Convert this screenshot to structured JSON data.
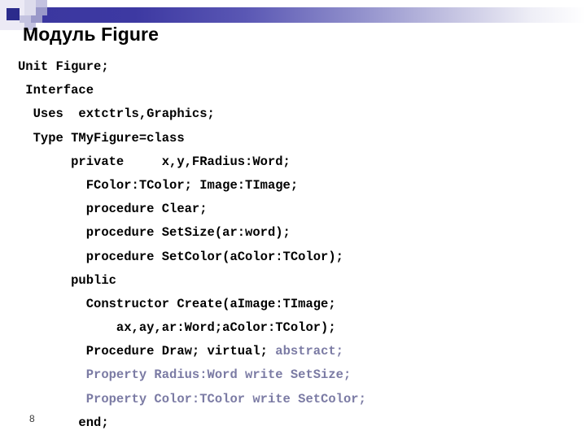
{
  "slide": {
    "title": "Модуль Figure",
    "page_number": "8",
    "colors": {
      "bar_start": "#3b37a0",
      "bar_end": "#ffffff",
      "square_dark": "#2b2b8c",
      "square_navy": "#3b37a0",
      "square_mid": "#9a99c9",
      "square_light": "#c3c2e0",
      "square_pale": "#dddcec",
      "dim_text": "#7b7ba4",
      "body_text": "#000000"
    }
  },
  "code": {
    "language": "pascal",
    "lines": [
      {
        "indent": 0,
        "segments": [
          {
            "text": "Unit Figure;",
            "style": "normal"
          }
        ]
      },
      {
        "indent": 1,
        "segments": [
          {
            "text": "Interface",
            "style": "normal"
          }
        ]
      },
      {
        "indent": 2,
        "segments": [
          {
            "text": "Uses  extctrls,Graphics;",
            "style": "normal"
          }
        ]
      },
      {
        "indent": 2,
        "segments": [
          {
            "text": "Type TMyFigure=class",
            "style": "normal"
          }
        ]
      },
      {
        "indent": 7,
        "segments": [
          {
            "text": "private     x,y,FRadius:Word;",
            "style": "normal"
          }
        ]
      },
      {
        "indent": 9,
        "segments": [
          {
            "text": "FColor:TColor; Image:TImage;",
            "style": "normal"
          }
        ]
      },
      {
        "indent": 9,
        "segments": [
          {
            "text": "procedure Clear;",
            "style": "normal"
          }
        ]
      },
      {
        "indent": 9,
        "segments": [
          {
            "text": "procedure SetSize(ar:word);",
            "style": "normal"
          }
        ]
      },
      {
        "indent": 9,
        "segments": [
          {
            "text": "procedure SetColor(aColor:TColor);",
            "style": "normal"
          }
        ]
      },
      {
        "indent": 7,
        "segments": [
          {
            "text": "public",
            "style": "normal"
          }
        ]
      },
      {
        "indent": 9,
        "segments": [
          {
            "text": "Constructor Create(aImage:TImage;",
            "style": "normal"
          }
        ]
      },
      {
        "indent": 13,
        "segments": [
          {
            "text": "ax,ay,ar:Word;aColor:TColor);",
            "style": "normal"
          }
        ]
      },
      {
        "indent": 9,
        "segments": [
          {
            "text": "Procedure Draw; virtual; ",
            "style": "normal"
          },
          {
            "text": "abstract;",
            "style": "dim"
          }
        ]
      },
      {
        "indent": 9,
        "segments": [
          {
            "text": "Property Radius:Word write SetSize;",
            "style": "dim"
          }
        ]
      },
      {
        "indent": 9,
        "segments": [
          {
            "text": "Property Color:TColor write SetColor;",
            "style": "dim"
          }
        ]
      },
      {
        "indent": 8,
        "segments": [
          {
            "text": "end;",
            "style": "normal"
          }
        ]
      }
    ]
  }
}
